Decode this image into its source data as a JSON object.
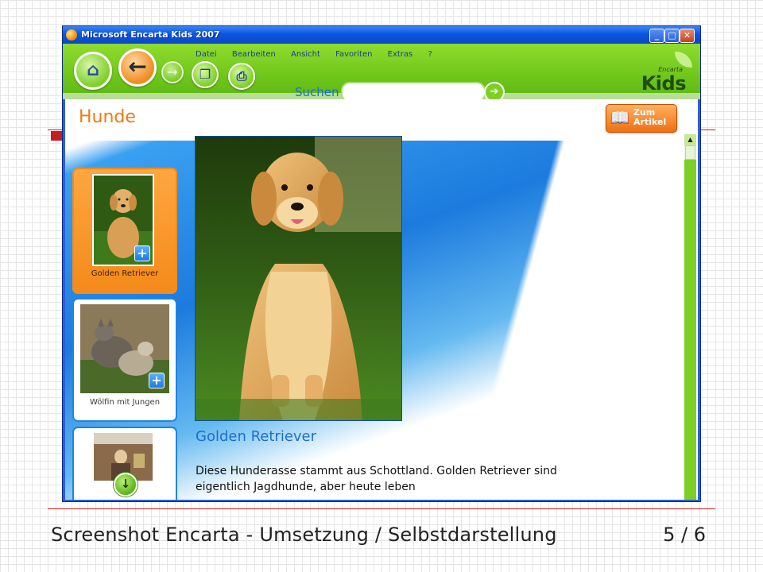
{
  "slide": {
    "footer_title": "Screenshot Encarta - Umsetzung / Selbstdarstellung",
    "page_number": "5 / 6"
  },
  "window": {
    "title": "Microsoft Encarta Kids 2007",
    "controls": {
      "minimize": "_",
      "maximize": "□",
      "close": "✕"
    }
  },
  "toolbar": {
    "menu": [
      "Datei",
      "Bearbeiten",
      "Ansicht",
      "Favoriten",
      "Extras",
      "?"
    ],
    "buttons": {
      "home_icon": "home-icon",
      "back_icon": "back-arrow-icon",
      "forward_icon": "forward-arrow-icon",
      "copy_icon": "copy-icon",
      "print_icon": "print-icon"
    },
    "search_label": "Suchen",
    "search_value": "",
    "search_go": "➔",
    "brand_small": "Encarta",
    "brand_big": "Kids"
  },
  "article": {
    "title": "Hunde",
    "zum_artikel": "Zum Artikel",
    "thumbnails": [
      {
        "label": "Golden Retriever",
        "active": true
      },
      {
        "label": "Wölfin mit Jungen",
        "active": false
      },
      {
        "label": "",
        "active": false
      }
    ],
    "caption_title": "Golden Retriever",
    "caption_text": "Diese Hunderasse stammt aus Schottland. Golden Retriever sind eigentlich Jagdhunde, aber heute leben"
  },
  "colors": {
    "accent_green": "#6fc61a",
    "accent_orange": "#f07a10",
    "accent_blue": "#1c6ed1",
    "window_titlebar": "#0b55e0",
    "slide_rule": "#c81e1e"
  }
}
